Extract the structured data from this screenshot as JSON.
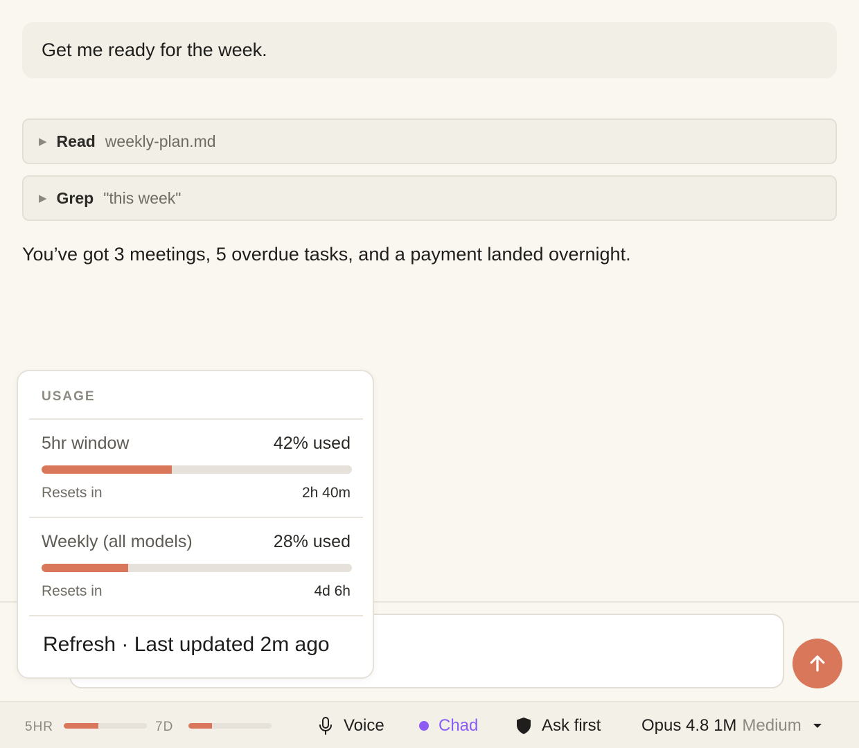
{
  "conversation": {
    "user_message": "Get me ready for the week.",
    "tools": [
      {
        "kind": "Read",
        "arg": "weekly-plan.md"
      },
      {
        "kind": "Grep",
        "arg": "\"this week\""
      }
    ],
    "reply": "You’ve got 3 meetings, 5 overdue tasks, and a payment landed overnight."
  },
  "usage": {
    "header": "USAGE",
    "windows": [
      {
        "title": "5hr window",
        "percent_label": "42% used",
        "percent": 42,
        "resets_label": "Resets in",
        "resets_value": "2h 40m"
      },
      {
        "title": "Weekly (all models)",
        "percent_label": "28% used",
        "percent": 28,
        "resets_label": "Resets in",
        "resets_value": "4d 6h"
      }
    ],
    "refresh": "Refresh · Last updated 2m ago"
  },
  "statusbar": {
    "limit_5hr_label": "5HR",
    "limit_5hr_percent": 42,
    "limit_7d_label": "7D",
    "limit_7d_percent": 28,
    "voice": "Voice",
    "agent": "Chad",
    "permission": "Ask first",
    "model": "Opus 4.8 1M",
    "effort": "Medium"
  },
  "colors": {
    "accent": "#d9775a",
    "agent": "#8b5cf6",
    "background": "#faf7f1"
  },
  "icons": {
    "send": "arrow-up-icon",
    "voice": "microphone-icon",
    "permission": "shield-icon",
    "model_menu": "caret-down-icon",
    "tool_expand": "triangle-right-icon"
  }
}
